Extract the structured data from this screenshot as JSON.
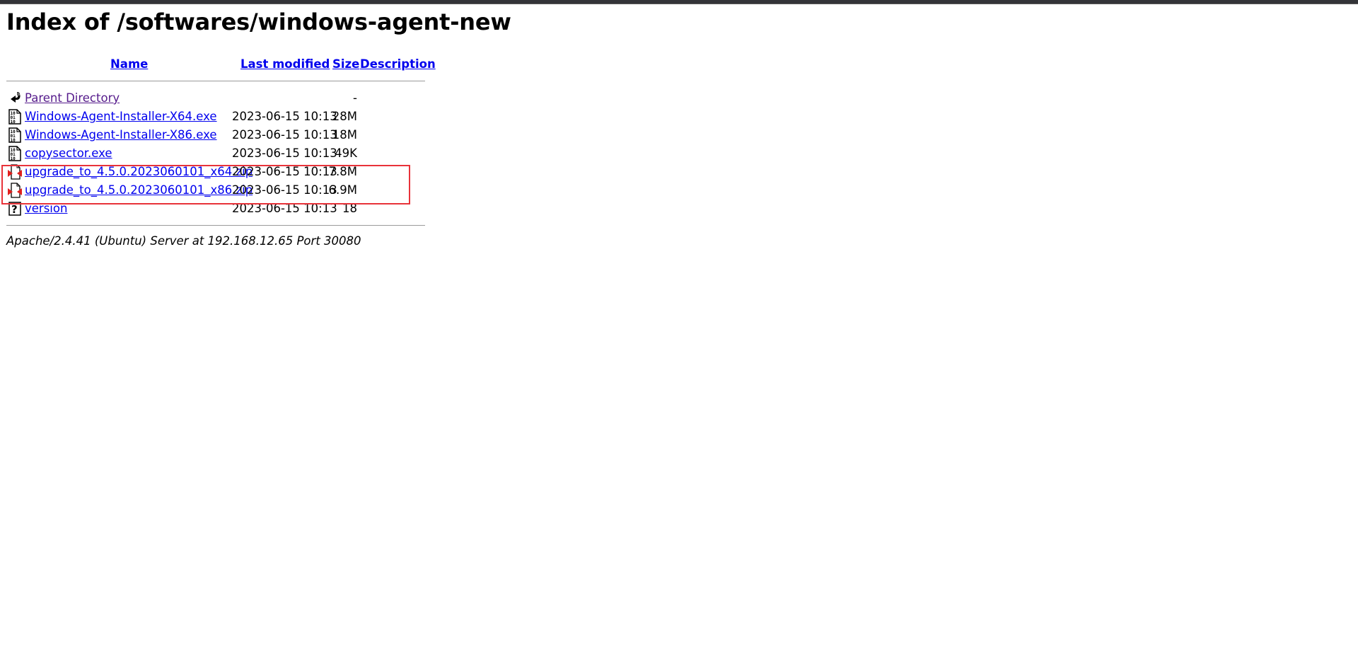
{
  "browser": {
    "topbar_color": "#333438"
  },
  "page": {
    "title": "Index of /softwares/windows-agent-new"
  },
  "table": {
    "headers": {
      "name": "Name",
      "last_modified": "Last modified",
      "size": "Size",
      "description": "Description"
    },
    "rows": [
      {
        "icon": "back-icon",
        "name": "Parent Directory",
        "date": "",
        "size": "-",
        "description": ""
      },
      {
        "icon": "binary-file-icon",
        "name": "Windows-Agent-Installer-X64.exe",
        "date": "2023-06-15 10:13",
        "size": "28M",
        "description": ""
      },
      {
        "icon": "binary-file-icon",
        "name": "Windows-Agent-Installer-X86.exe",
        "date": "2023-06-15 10:13",
        "size": "18M",
        "description": ""
      },
      {
        "icon": "binary-file-icon",
        "name": "copysector.exe",
        "date": "2023-06-15 10:13",
        "size": "49K",
        "description": ""
      },
      {
        "icon": "compressed-file-icon",
        "name": "upgrade_to_4.5.0.2023060101_x64.zip",
        "date": "2023-06-15 10:13",
        "size": "7.8M",
        "description": ""
      },
      {
        "icon": "compressed-file-icon",
        "name": "upgrade_to_4.5.0.2023060101_x86.zip",
        "date": "2023-06-15 10:13",
        "size": "6.9M",
        "description": ""
      },
      {
        "icon": "unknown-file-icon",
        "name": "version",
        "date": "2023-06-15 10:13",
        "size": "18",
        "description": ""
      }
    ]
  },
  "annotation": {
    "highlight_color": "#e8333a",
    "highlighted_rows": [
      4,
      5
    ]
  },
  "footer": {
    "text": "Apache/2.4.41 (Ubuntu) Server at 192.168.12.65 Port 30080"
  },
  "colors": {
    "link": "#0000ee",
    "visited_link": "#551a8b"
  }
}
